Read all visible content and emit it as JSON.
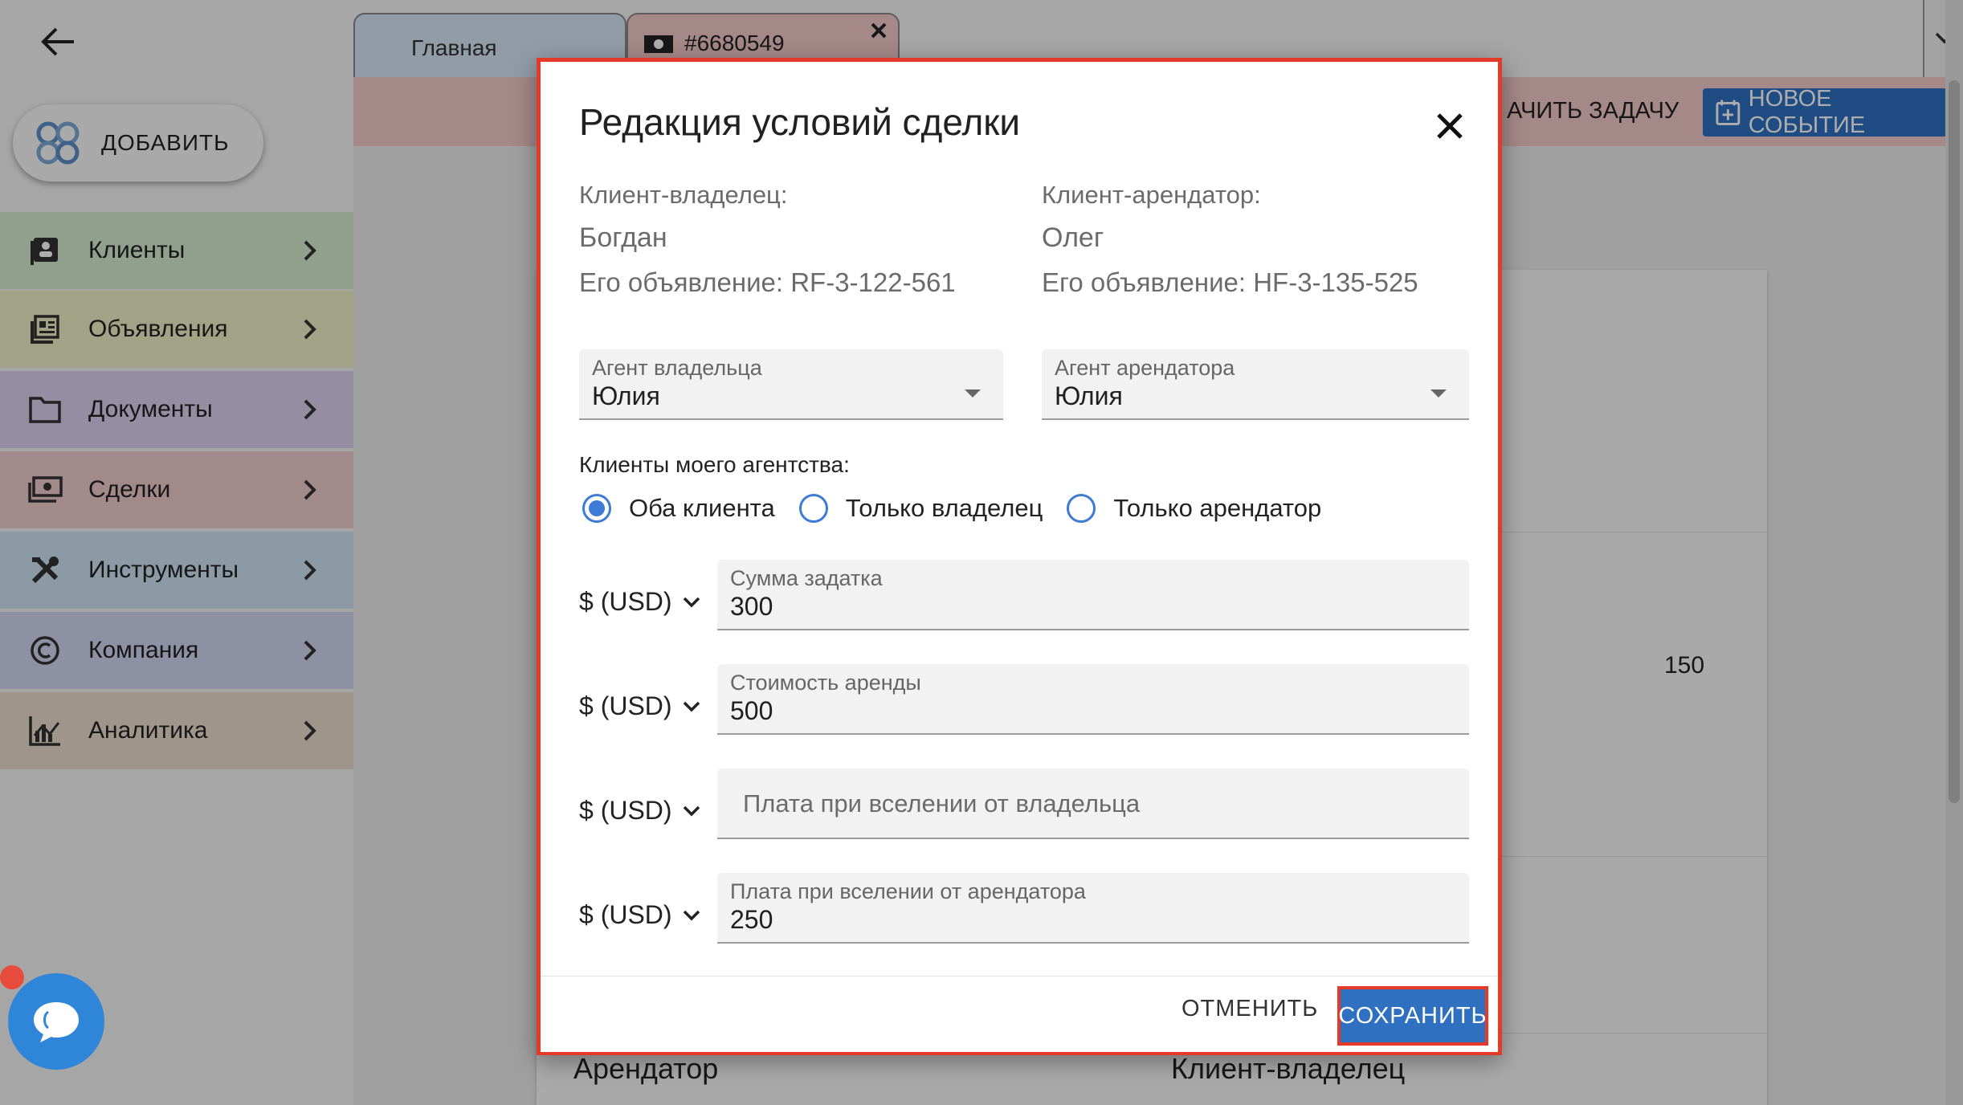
{
  "sidebar": {
    "add_label": "ДОБАВИТЬ",
    "items": [
      {
        "label": "Клиенты",
        "icon": "client-card-icon",
        "color": "#d6ecd0"
      },
      {
        "label": "Объявления",
        "icon": "listings-icon",
        "color": "#ecf0c6"
      },
      {
        "label": "Документы",
        "icon": "folder-icon",
        "color": "#dcd0ee"
      },
      {
        "label": "Сделки",
        "icon": "money-icon",
        "color": "#f0cccc"
      },
      {
        "label": "Инструменты",
        "icon": "tools-icon",
        "color": "#cde3f2"
      },
      {
        "label": "Компания",
        "icon": "copyright-icon",
        "color": "#d2d4f0"
      },
      {
        "label": "Аналитика",
        "icon": "analytics-icon",
        "color": "#ecdccc"
      }
    ]
  },
  "tabs": [
    {
      "label": "Главная"
    },
    {
      "label": "#6680549"
    }
  ],
  "toolbar": {
    "task_label": "АЧИТЬ ЗАДАЧУ",
    "event_label": "НОВОЕ СОБЫТИЕ"
  },
  "background": {
    "value_150": "150",
    "tenant_label": "Арендатор",
    "owner_label": "Клиент-владелец"
  },
  "dialog": {
    "title": "Редакция условий сделки",
    "owner": {
      "label": "Клиент-владелец:",
      "name": "Богдан",
      "listing": "Его объявление: RF-3-122-561"
    },
    "tenant": {
      "label": "Клиент-арендатор:",
      "name": "Олег",
      "listing": "Его объявление: HF-3-135-525"
    },
    "owner_agent": {
      "label": "Агент владельца",
      "value": "Юлия"
    },
    "tenant_agent": {
      "label": "Агент арендатора",
      "value": "Юлия"
    },
    "clients_label": "Клиенты моего агентства:",
    "radios": [
      {
        "label": "Оба клиента",
        "checked": true
      },
      {
        "label": "Только владелец",
        "checked": false
      },
      {
        "label": "Только арендатор",
        "checked": false
      }
    ],
    "currency": "$ (USD)",
    "fields": [
      {
        "label": "Сумма задатка",
        "value": "300"
      },
      {
        "label": "Стоимость аренды",
        "value": "500"
      },
      {
        "placeholder": "Плата при вселении от владельца"
      },
      {
        "label": "Плата при вселении от арендатора",
        "value": "250"
      }
    ],
    "cancel_label": "ОТМЕНИТЬ",
    "save_label": "СОХРАНИТЬ"
  },
  "colors": {
    "accent": "#2f70c1",
    "highlight": "#e53a2a"
  }
}
